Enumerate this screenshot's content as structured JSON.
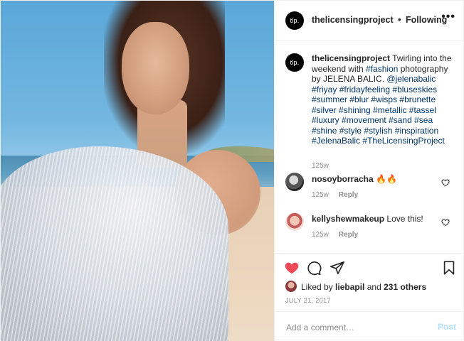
{
  "header": {
    "avatar_text": "tlp.",
    "username": "thelicensingproject",
    "separator": "•",
    "follow_status": "Following",
    "more": "•••"
  },
  "caption": {
    "avatar_text": "tlp.",
    "username": "thelicensingproject",
    "parts": [
      {
        "type": "text",
        "value": " Twirling into the weekend with "
      },
      {
        "type": "tag",
        "value": "#fashion"
      },
      {
        "type": "text",
        "value": " photography by JELENA BALIC. "
      },
      {
        "type": "tag",
        "value": "@jelenabalic"
      },
      {
        "type": "text",
        "value": " "
      },
      {
        "type": "tag",
        "value": "#friyay"
      },
      {
        "type": "text",
        "value": " "
      },
      {
        "type": "tag",
        "value": "#fridayfeeling"
      },
      {
        "type": "text",
        "value": " "
      },
      {
        "type": "tag",
        "value": "#bluseskies"
      },
      {
        "type": "text",
        "value": " "
      },
      {
        "type": "tag",
        "value": "#summer"
      },
      {
        "type": "text",
        "value": " "
      },
      {
        "type": "tag",
        "value": "#blur"
      },
      {
        "type": "text",
        "value": " "
      },
      {
        "type": "tag",
        "value": "#wisps"
      },
      {
        "type": "text",
        "value": " "
      },
      {
        "type": "tag",
        "value": "#brunette"
      },
      {
        "type": "text",
        "value": " "
      },
      {
        "type": "tag",
        "value": "#silver"
      },
      {
        "type": "text",
        "value": " "
      },
      {
        "type": "tag",
        "value": "#shining"
      },
      {
        "type": "text",
        "value": " "
      },
      {
        "type": "tag",
        "value": "#metallic"
      },
      {
        "type": "text",
        "value": " "
      },
      {
        "type": "tag",
        "value": "#tassel"
      },
      {
        "type": "text",
        "value": " "
      },
      {
        "type": "tag",
        "value": "#luxury"
      },
      {
        "type": "text",
        "value": " "
      },
      {
        "type": "tag",
        "value": "#movement"
      },
      {
        "type": "text",
        "value": " "
      },
      {
        "type": "tag",
        "value": "#sand"
      },
      {
        "type": "text",
        "value": " "
      },
      {
        "type": "tag",
        "value": "#sea"
      },
      {
        "type": "text",
        "value": " "
      },
      {
        "type": "tag",
        "value": "#shine"
      },
      {
        "type": "text",
        "value": " "
      },
      {
        "type": "tag",
        "value": "#style"
      },
      {
        "type": "text",
        "value": " "
      },
      {
        "type": "tag",
        "value": "#stylish"
      },
      {
        "type": "text",
        "value": " "
      },
      {
        "type": "tag",
        "value": "#inspiration"
      },
      {
        "type": "text",
        "value": " "
      },
      {
        "type": "tag",
        "value": "#JelenaBalic"
      },
      {
        "type": "text",
        "value": " "
      },
      {
        "type": "tag",
        "value": "#TheLicensingProject"
      }
    ],
    "time": "125w"
  },
  "comments": [
    {
      "username": "nosoyborracha",
      "text": "🔥🔥",
      "time": "125w",
      "reply": "Reply"
    },
    {
      "username": "kellyshewmakeup",
      "text": "Love this!",
      "time": "125w",
      "reply": "Reply"
    }
  ],
  "likes": {
    "prefix": "Liked by",
    "user": "liebapil",
    "conj": "and",
    "others": "231 others"
  },
  "date": "JULY 21, 2017",
  "add_comment": {
    "placeholder": "Add a comment…",
    "post_label": "Post"
  },
  "colors": {
    "like_red": "#ed4956",
    "hashtag": "#003569",
    "post_disabled": "#b2dffc"
  },
  "icons": [
    "heart-icon",
    "comment-icon",
    "share-icon",
    "bookmark-icon",
    "more-icon"
  ]
}
